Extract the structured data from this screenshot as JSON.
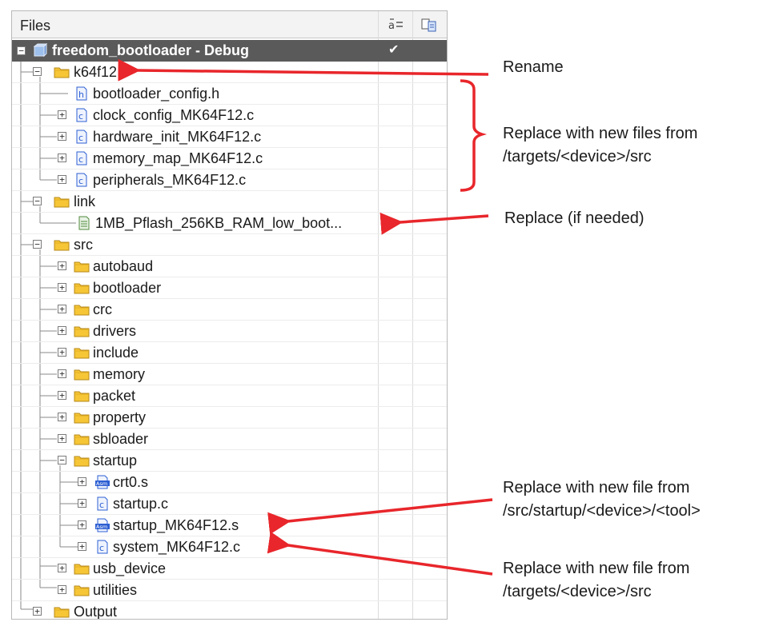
{
  "panel": {
    "title": "Files"
  },
  "project": {
    "name": "freedom_bootloader - Debug",
    "checked_glyph": "✔"
  },
  "tree": [
    {
      "label": "k64f12",
      "icon": "folder-icon"
    },
    {
      "label": "bootloader_config.h",
      "icon": "header-file-icon"
    },
    {
      "label": "clock_config_MK64F12.c",
      "icon": "c-file-icon"
    },
    {
      "label": "hardware_init_MK64F12.c",
      "icon": "c-file-icon"
    },
    {
      "label": "memory_map_MK64F12.c",
      "icon": "c-file-icon"
    },
    {
      "label": "peripherals_MK64F12.c",
      "icon": "c-file-icon"
    },
    {
      "label": "link",
      "icon": "folder-icon"
    },
    {
      "label": "1MB_Pflash_256KB_RAM_low_boot...",
      "icon": "linker-file-icon"
    },
    {
      "label": "src",
      "icon": "folder-icon"
    },
    {
      "label": "autobaud",
      "icon": "folder-icon"
    },
    {
      "label": "bootloader",
      "icon": "folder-icon"
    },
    {
      "label": "crc",
      "icon": "folder-icon"
    },
    {
      "label": "drivers",
      "icon": "folder-icon"
    },
    {
      "label": "include",
      "icon": "folder-icon"
    },
    {
      "label": "memory",
      "icon": "folder-icon"
    },
    {
      "label": "packet",
      "icon": "folder-icon"
    },
    {
      "label": "property",
      "icon": "folder-icon"
    },
    {
      "label": "sbloader",
      "icon": "folder-icon"
    },
    {
      "label": "startup",
      "icon": "folder-icon"
    },
    {
      "label": "crt0.s",
      "icon": "asm-file-icon"
    },
    {
      "label": "startup.c",
      "icon": "c-file-icon"
    },
    {
      "label": "startup_MK64F12.s",
      "icon": "asm-file-icon"
    },
    {
      "label": "system_MK64F12.c",
      "icon": "c-file-icon"
    },
    {
      "label": "usb_device",
      "icon": "folder-icon"
    },
    {
      "label": "utilities",
      "icon": "folder-icon"
    },
    {
      "label": "Output",
      "icon": "folder-icon"
    }
  ],
  "annotations": {
    "rename": "Rename",
    "replace_files_1": "Replace with  new files from",
    "replace_files_2": "/targets/<device>/src",
    "replace_if_needed": "Replace (if needed)",
    "replace_startup_1": "Replace with  new file from",
    "replace_startup_2": "/src/startup/<device>/<tool>",
    "replace_system_1": "Replace with  new file from",
    "replace_system_2": "/targets/<device>/src"
  },
  "colors": {
    "arrow": "#e8262b",
    "selection": "#5a5a5a",
    "folder": "#f6c637",
    "file_blue": "#2d5fd3"
  }
}
